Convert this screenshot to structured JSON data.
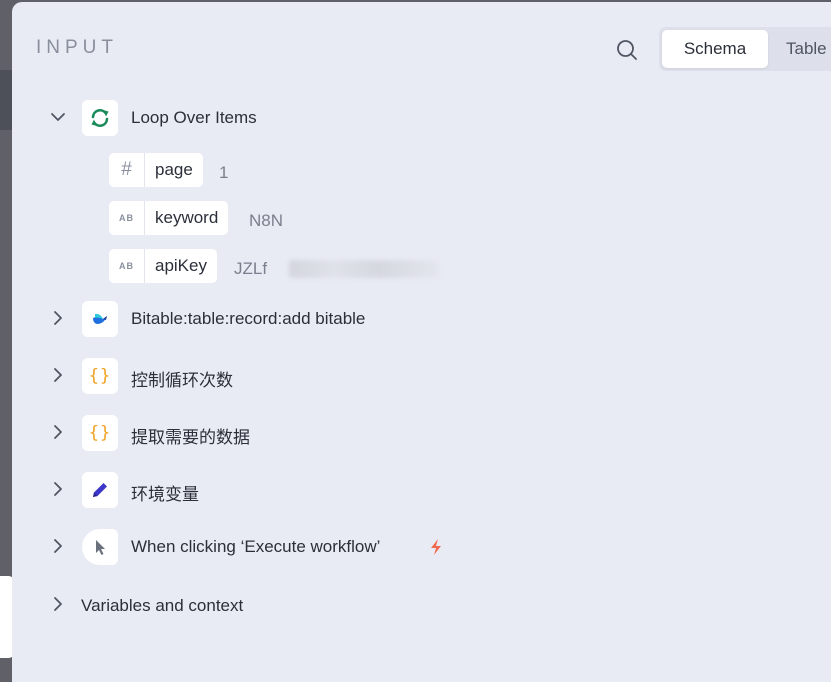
{
  "header": {
    "title": "INPUT",
    "tabs": [
      {
        "label": "Schema",
        "active": true
      },
      {
        "label": "Table",
        "active": false
      }
    ]
  },
  "nodes": [
    {
      "label": "Loop Over Items",
      "icon": "refresh-icon",
      "expanded": true,
      "fields": [
        {
          "type": "#",
          "name": "page",
          "value": "1"
        },
        {
          "type": "AB",
          "name": "keyword",
          "value": "N8N"
        },
        {
          "type": "AB",
          "name": "apiKey",
          "value": "JZLf"
        }
      ]
    },
    {
      "label": "Bitable:table:record:add bitable",
      "icon": "bitable-logo-icon",
      "expanded": false
    },
    {
      "label": "控制循环次数",
      "icon": "code-braces-icon",
      "icon_text": "{}",
      "expanded": false
    },
    {
      "label": "提取需要的数据",
      "icon": "code-braces-icon",
      "icon_text": "{}",
      "expanded": false
    },
    {
      "label": "环境变量",
      "icon": "pencil-icon",
      "expanded": false
    },
    {
      "label": "When clicking ‘Execute workflow’",
      "icon": "cursor-icon",
      "expanded": false
    }
  ],
  "variables": {
    "label": "Variables and context",
    "expanded": false
  },
  "colors": {
    "panel_bg": "#e9ebf4",
    "loop_icon": "#1a8a5a",
    "braces": "#f0a020",
    "pencil": "#3d37c9",
    "trigger_bolt": "#f06a50"
  }
}
